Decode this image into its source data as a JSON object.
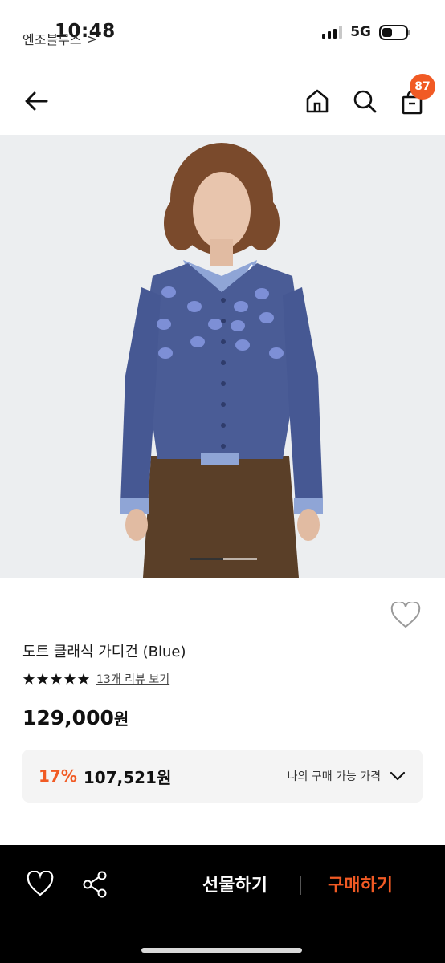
{
  "status_bar": {
    "time": "10:48",
    "network": "5G"
  },
  "nav": {
    "cart_count": "87"
  },
  "product": {
    "brand": "엔조블루스",
    "brand_chevron": ">",
    "name": "도트 클래식 가디건 (Blue)",
    "rating_stars": 5,
    "review_link": "13개 리뷰 보기",
    "price": "129,000",
    "price_unit": "원",
    "discount_rate": "17%",
    "discount_price": "107,521원",
    "discount_label": "나의 구매 가능 가격",
    "image_position": 0.5
  },
  "bottom_bar": {
    "gift_label": "선물하기",
    "buy_label": "구매하기"
  },
  "colors": {
    "accent": "#f15a24",
    "cardigan": "#4a5c96",
    "dot": "#7d8fd6",
    "skirt": "#5a3f28"
  }
}
